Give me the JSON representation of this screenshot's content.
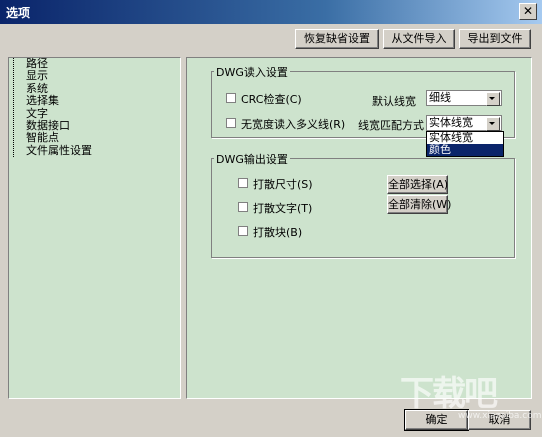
{
  "window": {
    "title": "选项",
    "close_icon": "close-icon"
  },
  "toolbar": {
    "restore_defaults": "恢复缺省设置",
    "import_from_file": "从文件导入",
    "export_to_file": "导出到文件"
  },
  "sidebar": {
    "items": [
      {
        "label": "路径"
      },
      {
        "label": "显示"
      },
      {
        "label": "系统"
      },
      {
        "label": "选择集"
      },
      {
        "label": "文字"
      },
      {
        "label": "数据接口"
      },
      {
        "label": "智能点"
      },
      {
        "label": "文件属性设置"
      }
    ]
  },
  "dwg_read": {
    "legend": "DWG读入设置",
    "crc_check": "CRC检查(C)",
    "read_no_width_polyline": "无宽度读入多义线(R)",
    "default_linewidth_label": "默认线宽",
    "default_linewidth_value": "细线",
    "linewidth_match_label": "线宽匹配方式",
    "linewidth_match_value": "实体线宽",
    "linewidth_match_options": [
      {
        "label": "实体线宽",
        "selected": false
      },
      {
        "label": "颜色",
        "selected": true
      }
    ]
  },
  "dwg_write": {
    "legend": "DWG输出设置",
    "explode_dimension": "打散尺寸(S)",
    "explode_text": "打散文字(T)",
    "explode_block": "打散块(B)",
    "select_all": "全部选择(A)",
    "clear_all": "全部清除(W)"
  },
  "footer": {
    "ok": "确定",
    "cancel": "取消"
  },
  "watermark": {
    "text": "下载吧",
    "url": "www.xiazaiba.com"
  },
  "colors": {
    "panel_bg": "#cde3cd",
    "title_bar": "#0a246a",
    "selection": "#0a246a"
  }
}
